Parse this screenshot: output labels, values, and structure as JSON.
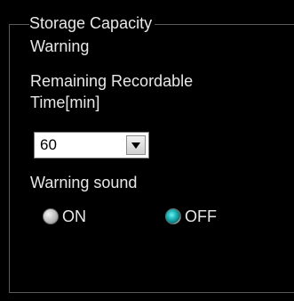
{
  "panel": {
    "title_line1": "Storage Capacity",
    "title_line2": "Warning",
    "remaining_label_line1": "Remaining Recordable",
    "remaining_label_line2": "Time[min]",
    "remaining_time": {
      "selected_value": "60"
    },
    "warning_sound_label": "Warning sound",
    "radio_on_label": "ON",
    "radio_off_label": "OFF",
    "selected_option": "OFF"
  }
}
